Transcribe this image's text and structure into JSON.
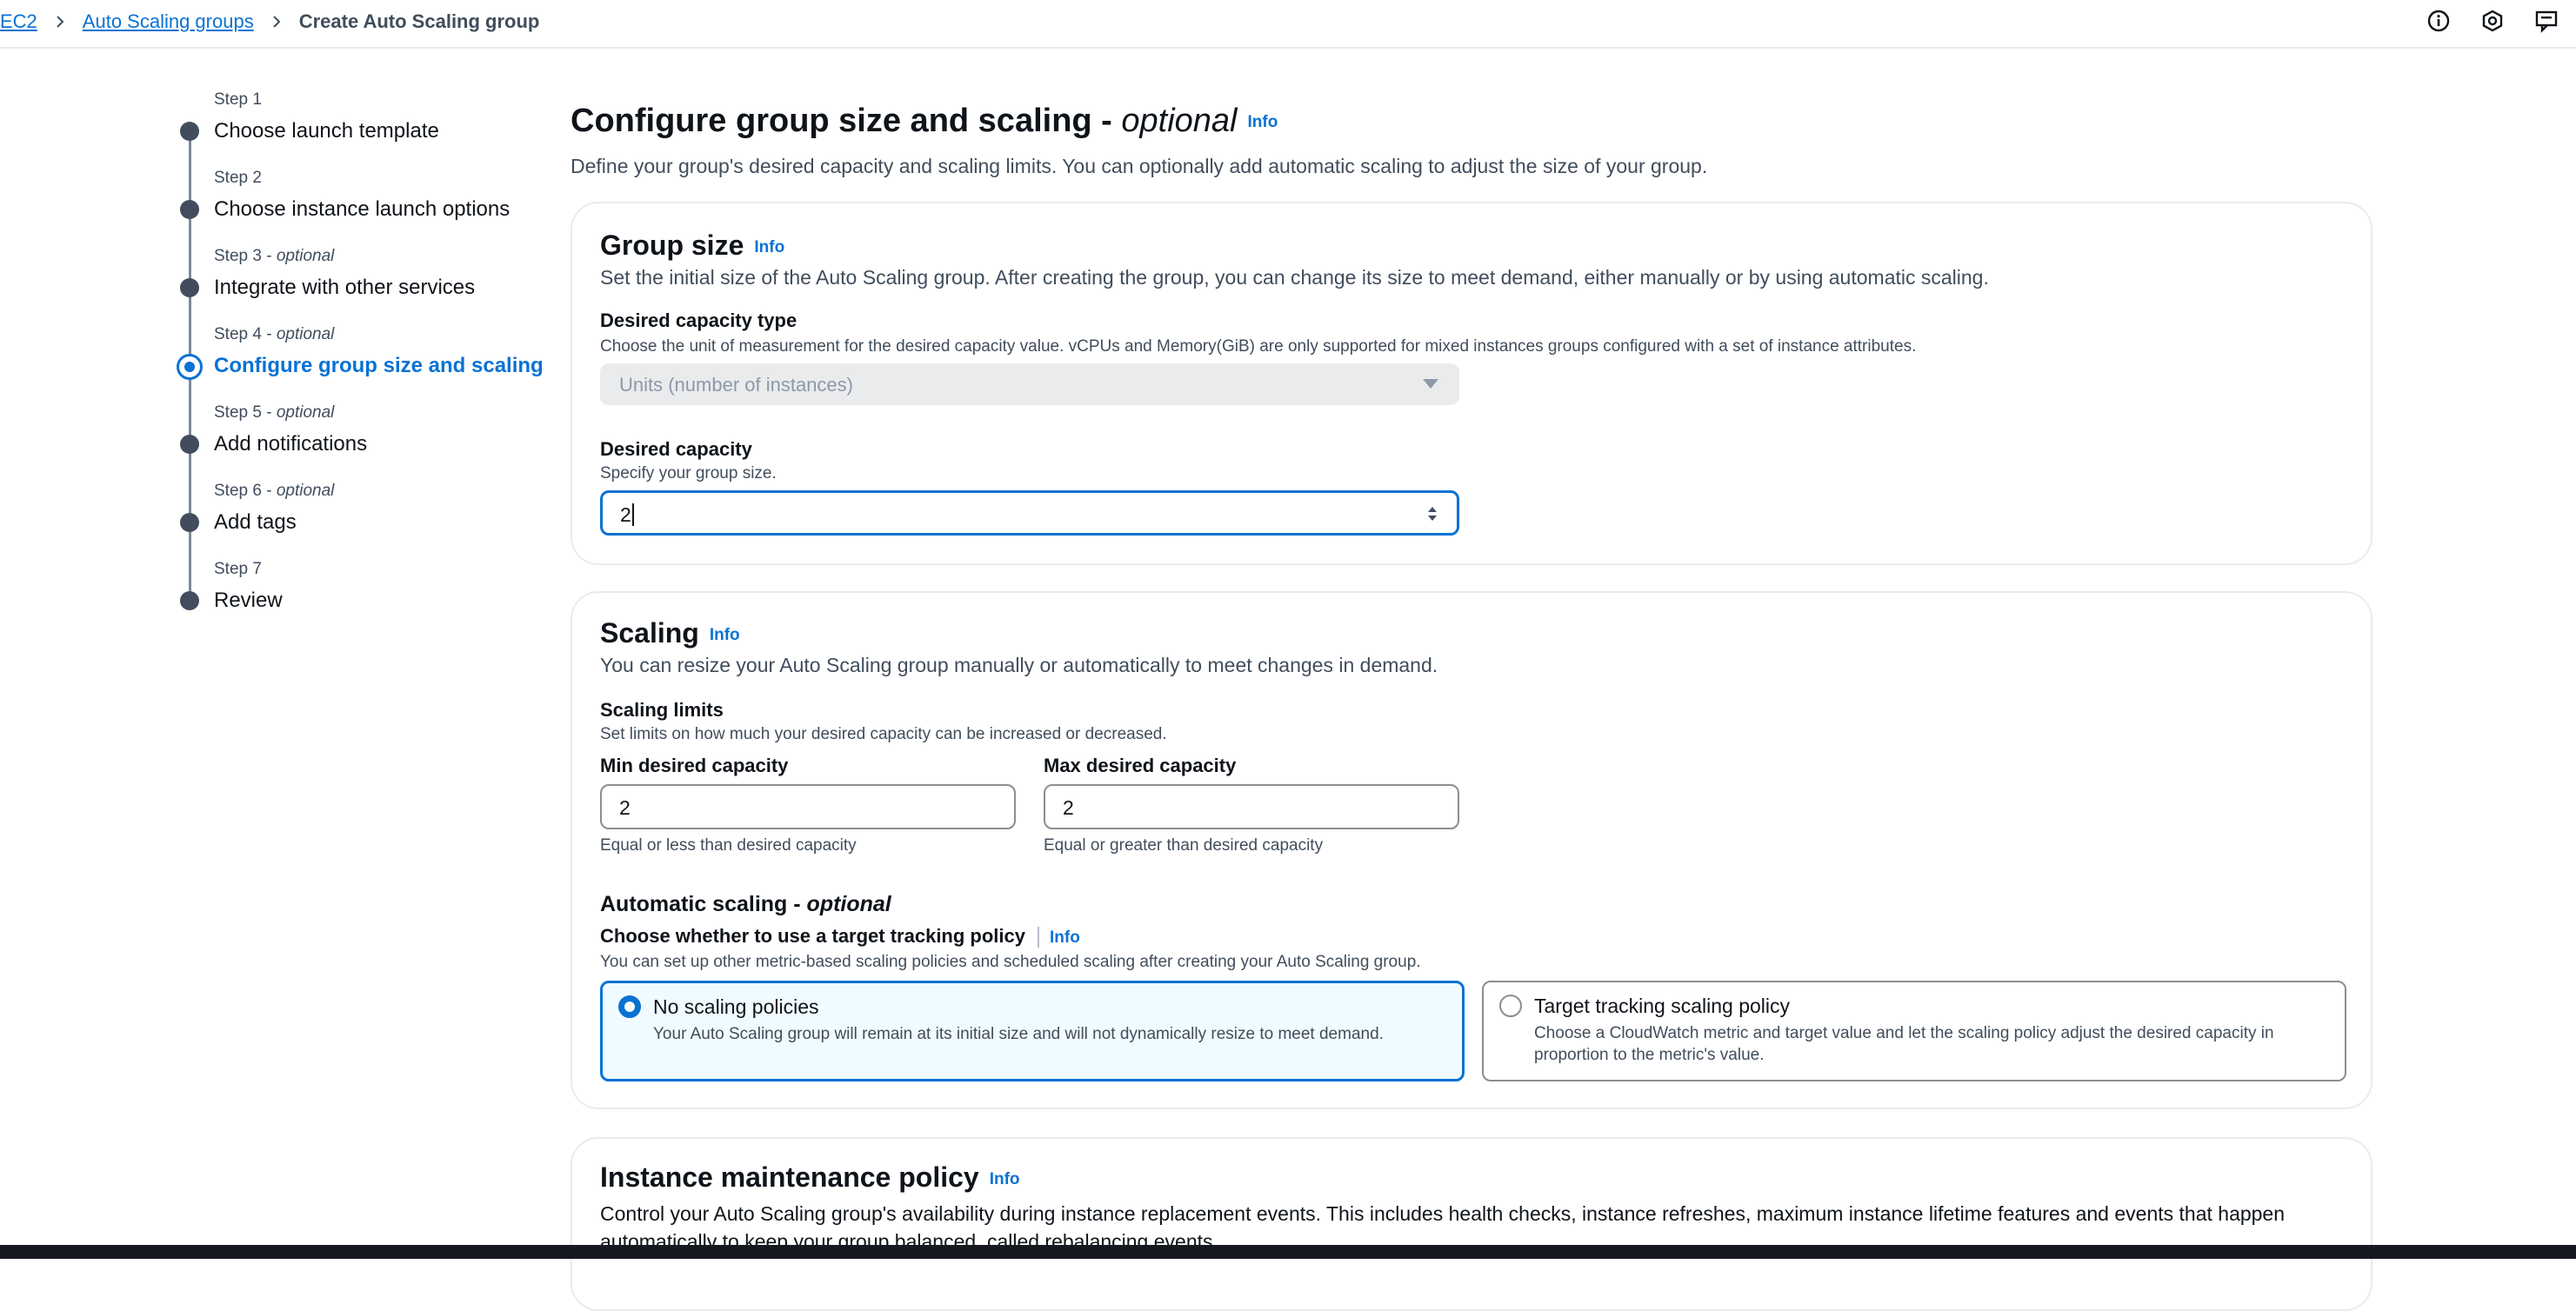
{
  "breadcrumbs": {
    "ec2": "EC2",
    "asg": "Auto Scaling groups",
    "current": "Create Auto Scaling group"
  },
  "top_icons": [
    "info-icon",
    "settings-hex-icon",
    "feedback-icon"
  ],
  "steps": [
    {
      "num": "Step 1",
      "optional": "",
      "title": "Choose launch template"
    },
    {
      "num": "Step 2",
      "optional": "",
      "title": "Choose instance launch options"
    },
    {
      "num": "Step 3 - ",
      "optional": "optional",
      "title": "Integrate with other services"
    },
    {
      "num": "Step 4 - ",
      "optional": "optional",
      "title": "Configure group size and scaling"
    },
    {
      "num": "Step 5 - ",
      "optional": "optional",
      "title": "Add notifications"
    },
    {
      "num": "Step 6 - ",
      "optional": "optional",
      "title": "Add tags"
    },
    {
      "num": "Step 7",
      "optional": "",
      "title": "Review"
    }
  ],
  "active_step": 3,
  "page": {
    "title": "Configure group size and scaling - ",
    "title_optional": "optional",
    "info": "Info",
    "description": "Define your group's desired capacity and scaling limits. You can optionally add automatic scaling to adjust the size of your group."
  },
  "group_size": {
    "title": "Group size",
    "info": "Info",
    "description": "Set the initial size of the Auto Scaling group. After creating the group, you can change its size to meet demand, either manually or by using automatic scaling.",
    "capacity_type_label": "Desired capacity type",
    "capacity_type_hint": "Choose the unit of measurement for the desired capacity value. vCPUs and Memory(GiB) are only supported for mixed instances groups configured with a set of instance attributes.",
    "capacity_type_value": "Units (number of instances)",
    "desired_label": "Desired capacity",
    "desired_hint": "Specify your group size.",
    "desired_value": "2"
  },
  "scaling": {
    "title": "Scaling",
    "info": "Info",
    "description": "You can resize your Auto Scaling group manually or automatically to meet changes in demand.",
    "limits_label": "Scaling limits",
    "limits_hint": "Set limits on how much your desired capacity can be increased or decreased.",
    "min_label": "Min desired capacity",
    "min_value": "2",
    "min_hint": "Equal or less than desired capacity",
    "max_label": "Max desired capacity",
    "max_value": "2",
    "max_hint": "Equal or greater than desired capacity",
    "auto_title": "Automatic scaling - ",
    "auto_optional": "optional",
    "policy_label": "Choose whether to use a target tracking policy",
    "policy_info": "Info",
    "policy_hint": "You can set up other metric-based scaling policies and scheduled scaling after creating your Auto Scaling group.",
    "option_none_title": "No scaling policies",
    "option_none_desc": "Your Auto Scaling group will remain at its initial size and will not dynamically resize to meet demand.",
    "option_tt_title": "Target tracking scaling policy",
    "option_tt_desc": "Choose a CloudWatch metric and target value and let the scaling policy adjust the desired capacity in proportion to the metric's value."
  },
  "maintenance": {
    "title": "Instance maintenance policy",
    "info": "Info",
    "description": "Control your Auto Scaling group's availability during instance replacement events. This includes health checks, instance refreshes, maximum instance lifetime features and events that happen automatically to keep your group balanced, called rebalancing events."
  },
  "colors": {
    "accent": "#0972d3",
    "text": "#0f141a",
    "muted": "#414d5c",
    "border": "#8c8c94"
  }
}
